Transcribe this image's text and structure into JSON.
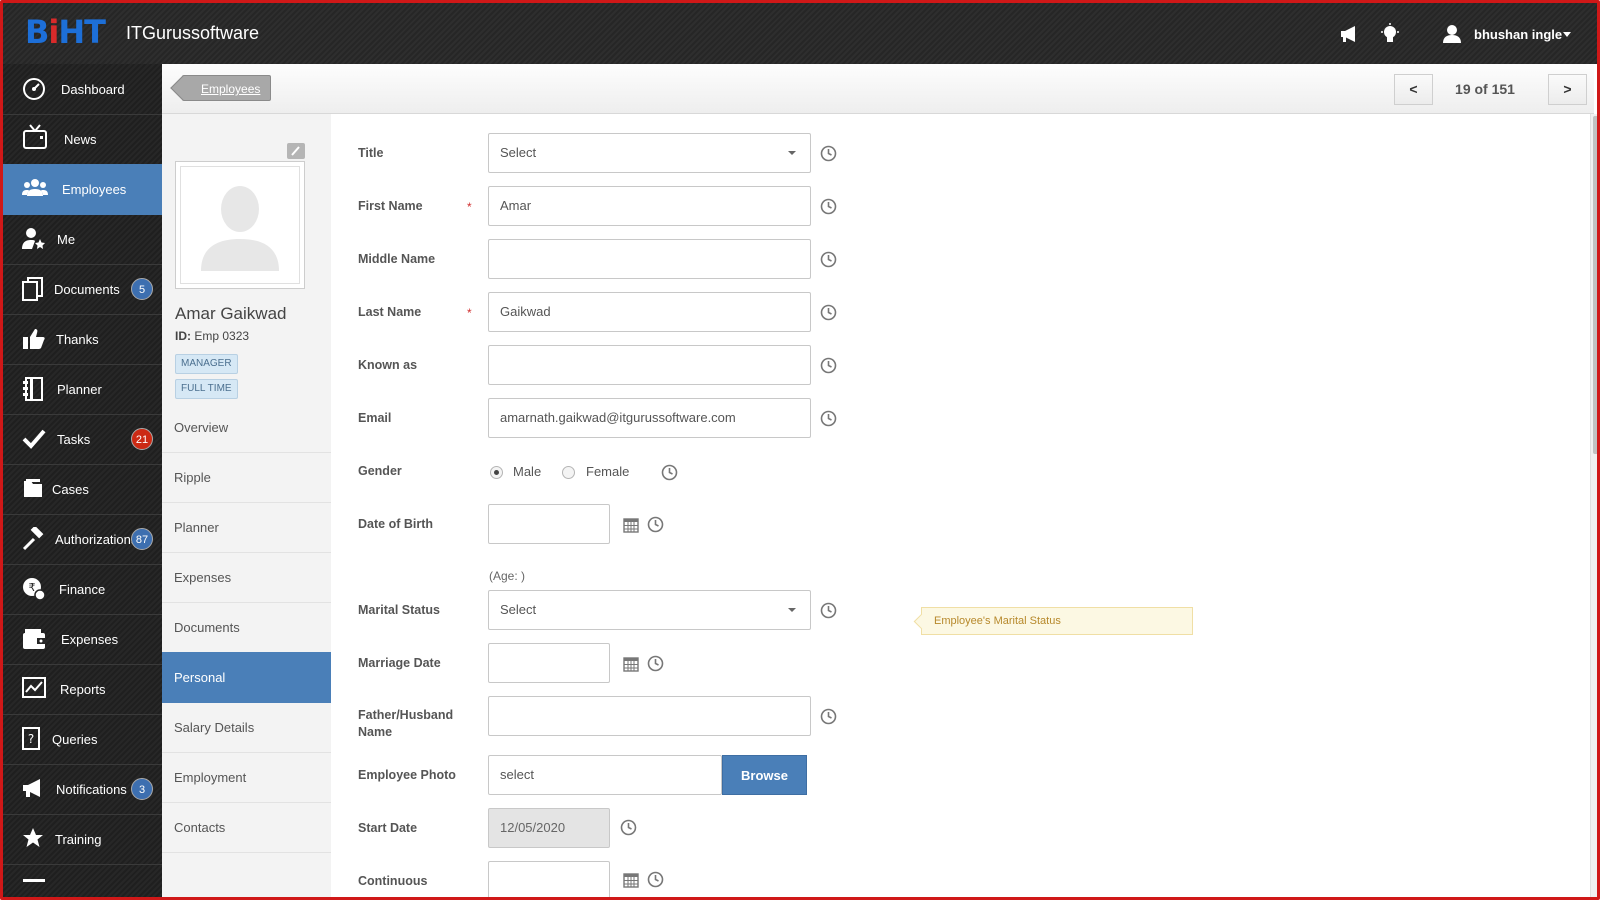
{
  "app": {
    "brand": "ITGurussoftware",
    "logo_text": "BiHT",
    "user_name": "bhushan ingle"
  },
  "sidebar": {
    "items": [
      {
        "label": "Dashboard",
        "icon": "dashboard-icon"
      },
      {
        "label": "News",
        "icon": "tv-icon"
      },
      {
        "label": "Employees",
        "icon": "users-icon",
        "active": true
      },
      {
        "label": "Me",
        "icon": "user-star-icon"
      },
      {
        "label": "Documents",
        "icon": "documents-icon",
        "badge": "5"
      },
      {
        "label": "Thanks",
        "icon": "thumbs-up-icon"
      },
      {
        "label": "Planner",
        "icon": "planner-icon"
      },
      {
        "label": "Tasks",
        "icon": "check-icon",
        "badge": "21"
      },
      {
        "label": "Cases",
        "icon": "folder-icon"
      },
      {
        "label": "Authorizations",
        "icon": "gavel-icon",
        "badge": "87"
      },
      {
        "label": "Finance",
        "icon": "rupee-icon"
      },
      {
        "label": "Expenses",
        "icon": "wallet-icon"
      },
      {
        "label": "Reports",
        "icon": "chart-icon"
      },
      {
        "label": "Queries",
        "icon": "question-icon"
      },
      {
        "label": "Notifications",
        "icon": "megaphone-icon",
        "badge": "3"
      },
      {
        "label": "Training",
        "icon": "star-icon"
      }
    ]
  },
  "header": {
    "breadcrumb": "Employees",
    "prev_label": "<",
    "next_label": ">",
    "pager_text": "19 of 151"
  },
  "profile": {
    "name": "Amar Gaikwad",
    "id_label": "ID:",
    "id_value": "Emp 0323",
    "tags": [
      "MANAGER",
      "FULL TIME"
    ],
    "menu": [
      "Overview",
      "Ripple",
      "Planner",
      "Expenses",
      "Documents",
      "Personal",
      "Salary Details",
      "Employment",
      "Contacts"
    ],
    "active_menu": "Personal"
  },
  "form": {
    "title": {
      "label": "Title",
      "value": "Select"
    },
    "first_name": {
      "label": "First Name",
      "value": "Amar",
      "required": "*"
    },
    "middle_name": {
      "label": "Middle Name",
      "value": ""
    },
    "last_name": {
      "label": "Last Name",
      "value": "Gaikwad",
      "required": "*"
    },
    "known_as": {
      "label": "Known as",
      "value": ""
    },
    "email": {
      "label": "Email",
      "value": "amarnath.gaikwad@itgurussoftware.com"
    },
    "gender": {
      "label": "Gender",
      "options": [
        "Male",
        "Female"
      ],
      "selected": "Male"
    },
    "dob": {
      "label": "Date of Birth",
      "value": "",
      "age": "(Age: )"
    },
    "marital_status": {
      "label": "Marital Status",
      "value": "Select",
      "hint": "Employee's Marital Status"
    },
    "marriage_date": {
      "label": "Marriage Date",
      "value": ""
    },
    "father_husband": {
      "label_line1": "Father/Husband",
      "label_line2": "Name",
      "value": ""
    },
    "employee_photo": {
      "label": "Employee Photo",
      "value": "select",
      "button": "Browse"
    },
    "start_date": {
      "label": "Start Date",
      "value": "12/05/2020"
    },
    "continuous": {
      "label": "Continuous",
      "value": ""
    }
  }
}
